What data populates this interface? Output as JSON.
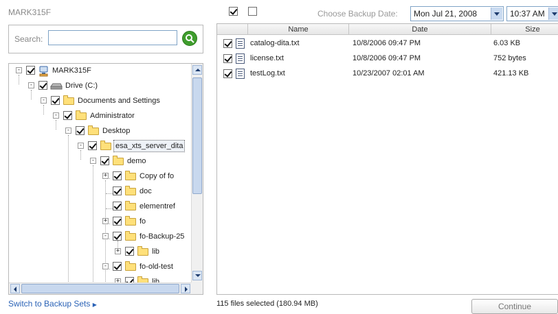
{
  "computer_name": "MARK315F",
  "search": {
    "label": "Search:",
    "value": "",
    "placeholder": ""
  },
  "tree": {
    "nodes": [
      {
        "label": "MARK315F",
        "icon": "computer-icon",
        "checked": true,
        "expander": "-"
      },
      {
        "label": "Drive (C:)",
        "icon": "drive-icon",
        "checked": true,
        "expander": "-"
      },
      {
        "label": "Documents and Settings",
        "icon": "folder-icon",
        "checked": true,
        "expander": "-"
      },
      {
        "label": "Administrator",
        "icon": "folder-icon",
        "checked": true,
        "expander": "-"
      },
      {
        "label": "Desktop",
        "icon": "folder-icon",
        "checked": true,
        "expander": "-"
      },
      {
        "label": "esa_xts_server_dita",
        "icon": "folder-icon",
        "checked": true,
        "expander": "-",
        "selected": true
      },
      {
        "label": "demo",
        "icon": "folder-icon",
        "checked": true,
        "expander": "-"
      },
      {
        "label": "Copy of fo",
        "icon": "folder-icon",
        "checked": true,
        "expander": "+"
      },
      {
        "label": "doc",
        "icon": "folder-icon",
        "checked": true,
        "expander": ""
      },
      {
        "label": "elementref",
        "icon": "folder-icon",
        "checked": true,
        "expander": ""
      },
      {
        "label": "fo",
        "icon": "folder-icon",
        "checked": true,
        "expander": "+"
      },
      {
        "label": "fo-Backup-25",
        "icon": "folder-icon",
        "checked": true,
        "expander": "-"
      },
      {
        "label": "lib",
        "icon": "folder-icon",
        "checked": true,
        "expander": "+"
      },
      {
        "label": "fo-old-test",
        "icon": "folder-icon",
        "checked": true,
        "expander": "-"
      },
      {
        "label": "lib",
        "icon": "folder-icon",
        "checked": true,
        "expander": "+"
      }
    ]
  },
  "switch_link": "Switch to Backup Sets",
  "select_all_checked": true,
  "select_none_checked": false,
  "choose_backup_date_label": "Choose Backup Date:",
  "backup_date": "Mon Jul 21, 2008",
  "backup_time": "10:37 AM",
  "table": {
    "columns": [
      "Name",
      "Date",
      "Size"
    ],
    "rows": [
      {
        "name": "catalog-dita.txt",
        "date": "10/8/2006 09:47 PM",
        "size": "6.03 KB",
        "checked": true
      },
      {
        "name": "license.txt",
        "date": "10/8/2006 09:47 PM",
        "size": "752 bytes",
        "checked": true
      },
      {
        "name": "testLog.txt",
        "date": "10/23/2007 02:01 AM",
        "size": "421.13 KB",
        "checked": true
      }
    ]
  },
  "files_selected": "115 files selected (180.94 MB)",
  "continue_label": "Continue",
  "colors": {
    "accent": "#3f9d2d",
    "link": "#2a62b6",
    "border": "#b9b9b9",
    "scroll": "#c8d8ee"
  }
}
